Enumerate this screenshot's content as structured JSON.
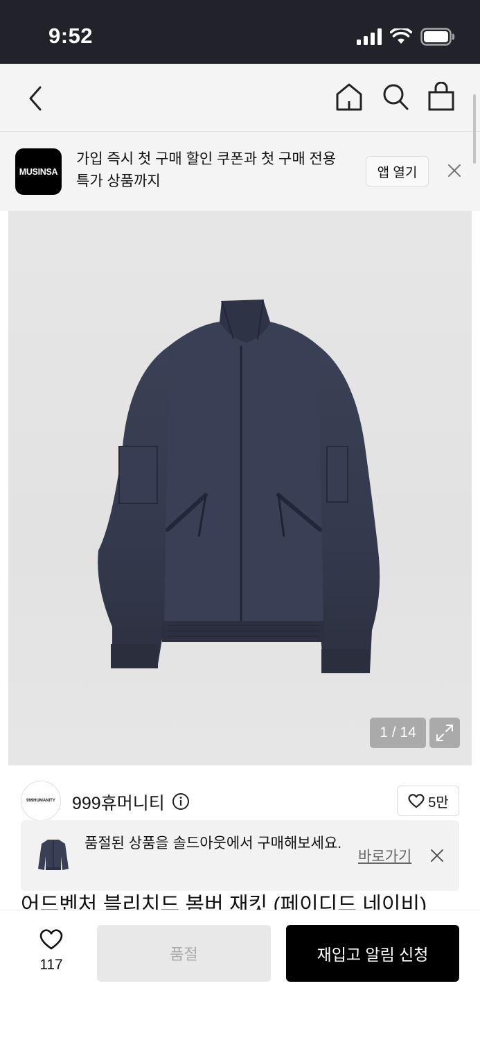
{
  "status_bar": {
    "time": "9:52"
  },
  "promo": {
    "logo_text": "MUSINSA",
    "message": "가입 즉시 첫 구매 할인 쿠폰과 첫 구매 전용 특가 상품까지",
    "open_app_label": "앱 열기"
  },
  "gallery": {
    "counter": "1 / 14"
  },
  "brand": {
    "logo_text": "999HUMANITY",
    "name": "999휴머니티",
    "likes": "5만"
  },
  "soldout_notice": {
    "message": "품절된 상품을 솔드아웃에서 구매해보세요.",
    "link_label": "바로가기"
  },
  "product": {
    "title": "어드벤처 블리치드 봄버 재킷 (페이디드 네이비)"
  },
  "bottom_bar": {
    "wish_count": "117",
    "soldout_label": "품절",
    "restock_label": "재입고 알림 신청"
  }
}
